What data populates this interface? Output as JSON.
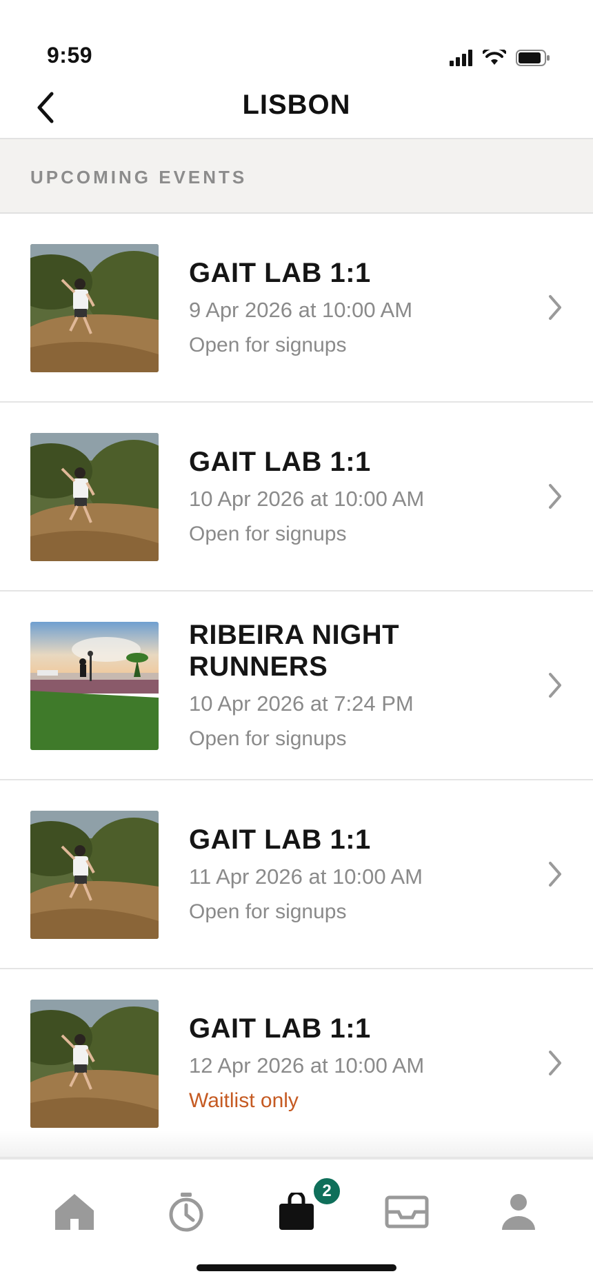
{
  "status_bar": {
    "time": "9:59",
    "icons": [
      "cellular-signal-icon",
      "wifi-icon",
      "battery-icon"
    ]
  },
  "header": {
    "title": "LISBON",
    "back_icon": "chevron-left-icon"
  },
  "section": {
    "title": "UPCOMING EVENTS"
  },
  "events": [
    {
      "title": "GAIT LAB 1:1",
      "date": "9 Apr 2026 at 10:00 AM",
      "status": "Open for signups",
      "thumb": "trail-runner-photo"
    },
    {
      "title": "GAIT LAB 1:1",
      "date": "10 Apr 2026 at 10:00 AM",
      "status": "Open for signups",
      "thumb": "trail-runner-photo"
    },
    {
      "title": "RIBEIRA NIGHT RUNNERS",
      "date": "10 Apr 2026 at 7:24 PM",
      "status": "Open for signups",
      "thumb": "waterfront-runner-photo"
    },
    {
      "title": "GAIT LAB 1:1",
      "date": "11 Apr 2026 at 10:00 AM",
      "status": "Open for signups",
      "thumb": "trail-runner-photo"
    },
    {
      "title": "GAIT LAB 1:1",
      "date": "12 Apr 2026 at 10:00 AM",
      "status": "Waitlist only",
      "thumb": "trail-runner-photo"
    }
  ],
  "tab_bar": {
    "tabs": [
      {
        "icon": "home-icon"
      },
      {
        "icon": "stopwatch-icon"
      },
      {
        "icon": "bag-icon",
        "active": true,
        "badge": "2"
      },
      {
        "icon": "inbox-icon"
      },
      {
        "icon": "profile-icon"
      }
    ]
  },
  "colors": {
    "accent_badge": "#0f6f5a",
    "waitlist": "#c55a22",
    "muted_text": "#8a8a8a",
    "section_bg": "#f3f2f0"
  }
}
